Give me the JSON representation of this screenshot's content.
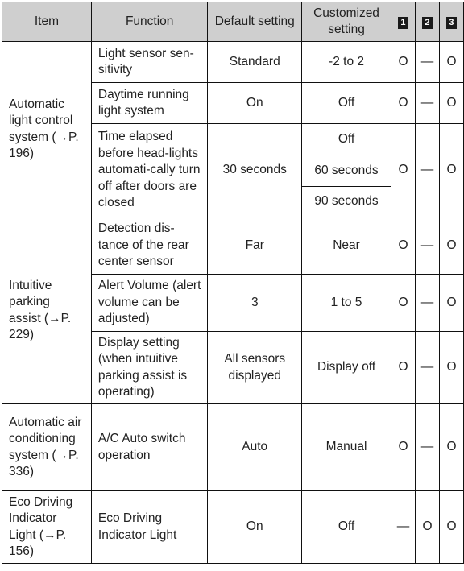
{
  "header": {
    "item": "Item",
    "function": "Function",
    "default": "Default setting",
    "customized": "Customized setting",
    "col1": "1",
    "col2": "2",
    "col3": "3"
  },
  "groups": [
    {
      "item": "Automatic light control system (→P. 196)",
      "rows": [
        {
          "function": "Light sensor sen-sitivity",
          "default": "Standard",
          "customized": [
            "-2 to 2"
          ],
          "c1": "O",
          "c2": "—",
          "c3": "O"
        },
        {
          "function": "Daytime running light system",
          "default": "On",
          "customized": [
            "Off"
          ],
          "c1": "O",
          "c2": "—",
          "c3": "O"
        },
        {
          "function": "Time elapsed before head-lights automati-cally turn off after doors are closed",
          "default": "30 seconds",
          "customized": [
            "Off",
            "60 seconds",
            "90 seconds"
          ],
          "c1": "O",
          "c2": "—",
          "c3": "O"
        }
      ]
    },
    {
      "item": "Intuitive parking assist (→P. 229)",
      "rows": [
        {
          "function": "Detection dis-tance of the rear center sensor",
          "default": "Far",
          "customized": [
            "Near"
          ],
          "c1": "O",
          "c2": "—",
          "c3": "O"
        },
        {
          "function": "Alert Volume (alert volume can be adjusted)",
          "default": "3",
          "customized": [
            "1 to 5"
          ],
          "c1": "O",
          "c2": "—",
          "c3": "O"
        },
        {
          "function": "Display setting (when intuitive parking assist is operating)",
          "default": "All sensors displayed",
          "customized": [
            "Display off"
          ],
          "c1": "O",
          "c2": "—",
          "c3": "O"
        }
      ]
    },
    {
      "item": "Automatic air conditioning system (→P. 336)",
      "rows": [
        {
          "function": "A/C Auto switch operation",
          "default": "Auto",
          "customized": [
            "Manual"
          ],
          "c1": "O",
          "c2": "—",
          "c3": "O"
        }
      ]
    },
    {
      "item": "Eco Driving Indicator Light (→P. 156)",
      "rows": [
        {
          "function": "Eco Driving Indicator Light",
          "default": "On",
          "customized": [
            "Off"
          ],
          "c1": "—",
          "c2": "O",
          "c3": "O"
        }
      ]
    }
  ]
}
